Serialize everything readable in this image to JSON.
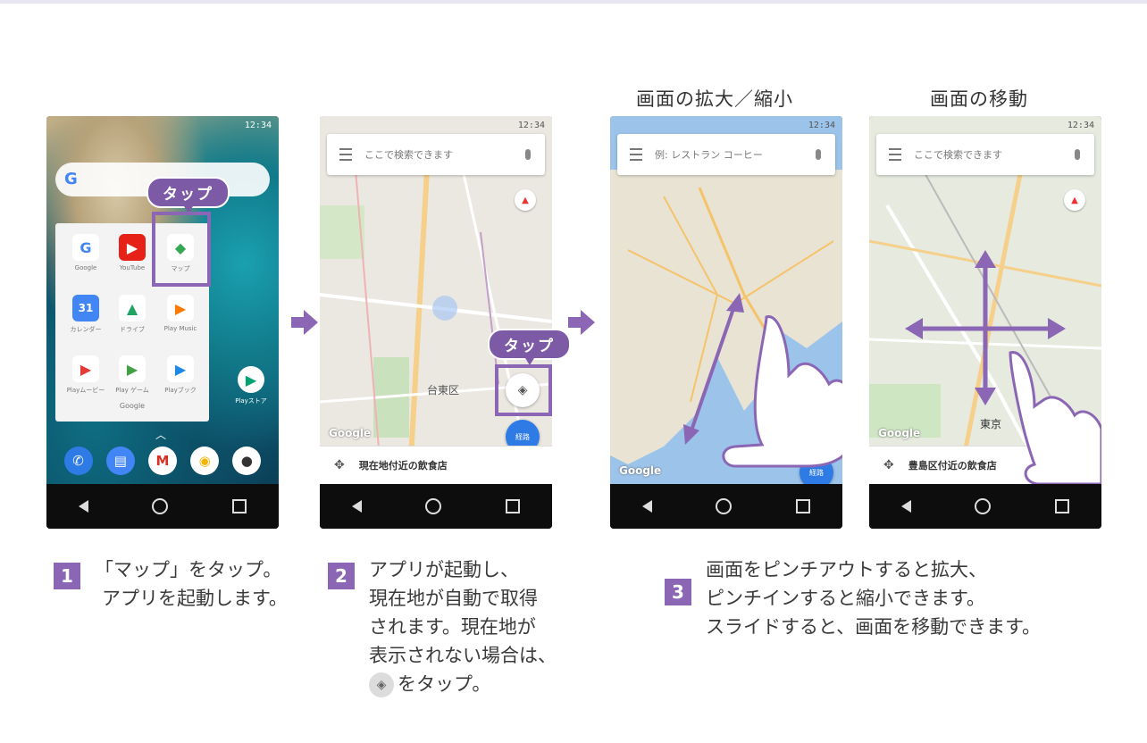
{
  "captions": {
    "zoom": "画面の拡大／縮小",
    "move": "画面の移動"
  },
  "tap_label": "タップ",
  "status_time": "12:34",
  "home": {
    "search_g": "G",
    "folder_name": "Google",
    "apps": [
      {
        "label": "Google",
        "glyph": "G",
        "color": "#4285f4"
      },
      {
        "label": "YouTube",
        "glyph": "▶",
        "color": "#e62117"
      },
      {
        "label": "マップ",
        "glyph": "◆",
        "color": "#34a853"
      },
      {
        "label": "カレンダー",
        "glyph": "31",
        "color": "#4285f4"
      },
      {
        "label": "ドライブ",
        "glyph": "▲",
        "color": "#fbbc05"
      },
      {
        "label": "Play Music",
        "glyph": "▶",
        "color": "#ff7a00"
      },
      {
        "label": "Playムービー",
        "glyph": "▶",
        "color": "#e53935"
      },
      {
        "label": "Play ゲーム",
        "glyph": "▶",
        "color": "#43a047"
      },
      {
        "label": "Playブック",
        "glyph": "▶",
        "color": "#1e88e5"
      }
    ],
    "playstore_label": "Playストア",
    "dock": [
      "✆",
      "▤",
      "M",
      "◉",
      "●"
    ]
  },
  "map2": {
    "search_placeholder": "ここで検索できます",
    "bottom_text": "現在地付近の飲食店",
    "district": "台東区",
    "google": "Google",
    "route": "経路"
  },
  "map3": {
    "search_placeholder": "例: レストラン コーヒー",
    "google": "Google",
    "route": "経路"
  },
  "map4": {
    "search_placeholder": "ここで検索できます",
    "bottom_text": "豊島区付近の飲食店",
    "district": "東京",
    "google": "Google"
  },
  "steps": [
    {
      "num": "1",
      "lines": [
        "「マップ」をタップ。",
        "アプリを起動します。"
      ]
    },
    {
      "num": "2",
      "lines": [
        "アプリが起動し、",
        "現在地が自動で取得",
        "されます。現在地が",
        "表示されない場合は、"
      ],
      "last_line": "をタップ。"
    },
    {
      "num": "3",
      "lines": [
        "画面をピンチアウトすると拡大、",
        "ピンチインすると縮小できます。",
        "スライドすると、画面を移動できます。"
      ]
    }
  ],
  "colors": {
    "accent": "#8b66b4",
    "route_fab": "#2e7be5"
  }
}
